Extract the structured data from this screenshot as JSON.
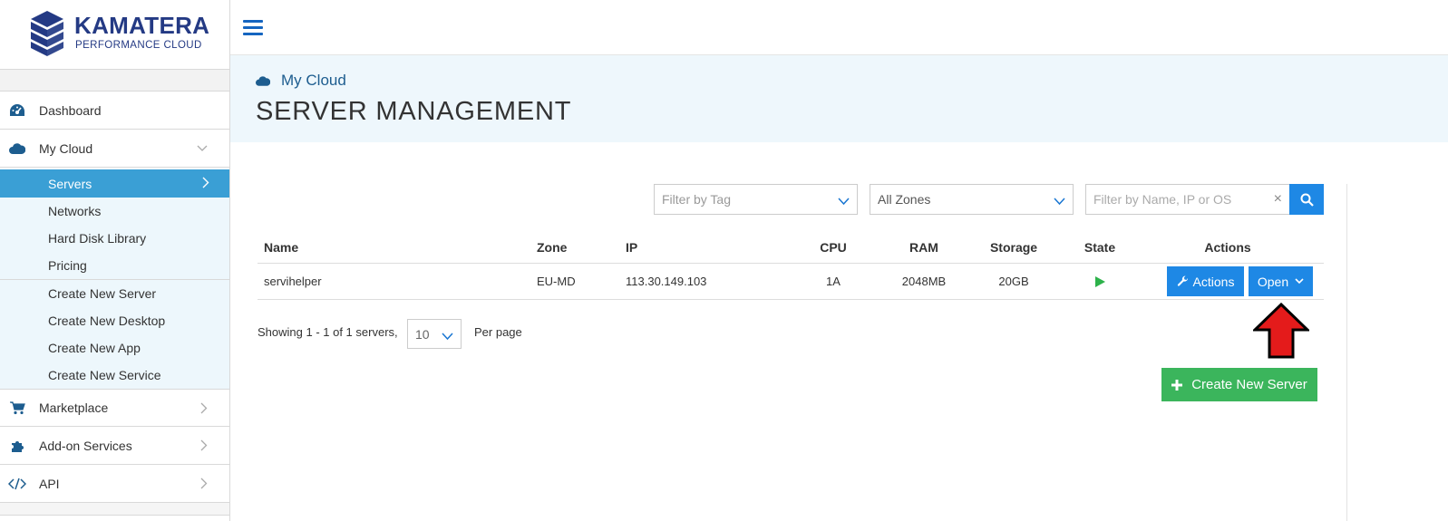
{
  "brand": {
    "name": "KAMATERA",
    "tagline": "PERFORMANCE CLOUD",
    "color": "#243a84"
  },
  "sidebar": {
    "items": [
      {
        "label": "Dashboard",
        "icon": "dashboard-icon"
      },
      {
        "label": "My Cloud",
        "icon": "cloud-icon",
        "expanded": true
      }
    ],
    "my_cloud_sub": [
      {
        "label": "Servers",
        "active": true
      },
      {
        "label": "Networks"
      },
      {
        "label": "Hard Disk Library"
      },
      {
        "label": "Pricing"
      }
    ],
    "create_sub": [
      {
        "label": "Create New Server"
      },
      {
        "label": "Create New Desktop"
      },
      {
        "label": "Create New App"
      },
      {
        "label": "Create New Service"
      }
    ],
    "bottom_items": [
      {
        "label": "Marketplace",
        "icon": "cart-icon"
      },
      {
        "label": "Add-on Services",
        "icon": "puzzle-icon"
      },
      {
        "label": "API",
        "icon": "code-icon"
      }
    ]
  },
  "header": {
    "breadcrumb": "My Cloud",
    "title": "SERVER MANAGEMENT"
  },
  "filters": {
    "tag_placeholder": "Filter by Tag",
    "zone_selected": "All Zones",
    "search_placeholder": "Filter by Name, IP or OS",
    "clear": "×"
  },
  "table": {
    "columns": [
      "Name",
      "Zone",
      "IP",
      "CPU",
      "RAM",
      "Storage",
      "State",
      "Actions"
    ],
    "rows": [
      {
        "name": "servihelper",
        "zone": "EU-MD",
        "ip": "113.30.149.103",
        "cpu": "1A",
        "ram": "2048MB",
        "storage": "20GB",
        "state": "running"
      }
    ],
    "actions_label": "Actions",
    "open_label": "Open"
  },
  "pagination": {
    "showing": "Showing 1 - 1 of 1 servers,",
    "per_page_value": "10",
    "per_page_label": "Per page"
  },
  "create_button": "Create New Server",
  "colors": {
    "accent": "#1e88e5",
    "active_nav": "#3a9fd5",
    "success": "#3bb55c",
    "annotation_arrow": "#e41b1b"
  }
}
